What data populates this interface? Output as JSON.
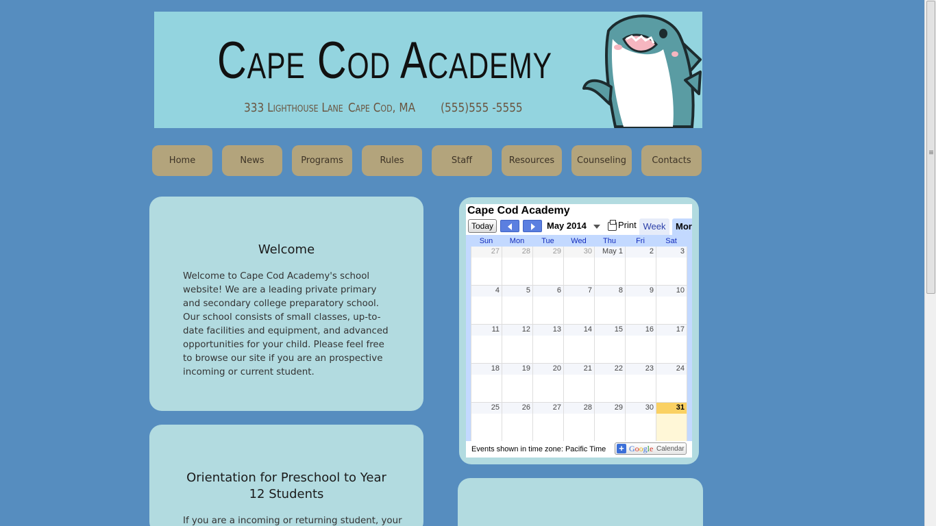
{
  "banner": {
    "title": "Cape Cod Academy",
    "street": "333 Lighthouse Lane",
    "city": "Cape Cod, MA",
    "phone": "(555)555 -5555",
    "mascot": "shark-mascot"
  },
  "nav": {
    "items": [
      {
        "label": "Home"
      },
      {
        "label": "News"
      },
      {
        "label": "Programs"
      },
      {
        "label": "Rules"
      },
      {
        "label": "Staff"
      },
      {
        "label": "Resources"
      },
      {
        "label": "Counseling"
      },
      {
        "label": "Contacts"
      }
    ]
  },
  "welcome": {
    "title": "Welcome",
    "text": "Welcome to Cape Cod Academy's school website! We are a leading private primary and secondary college preparatory school. Our school consists of small classes, up-to-date facilities and equipment, and advanced opportunities for your child. Please feel free to browse our site if you are an prospective incoming or current student."
  },
  "orientation": {
    "title": "Orientation for Preschool to Year 12 Students",
    "text": "If you are a incoming or returning student, your"
  },
  "calendar": {
    "title": "Cape Cod Academy",
    "today_label": "Today",
    "month_label": "May 2014",
    "print_label": "Print",
    "tab_week": "Week",
    "tab_month": "Mor",
    "weekdays": [
      "Sun",
      "Mon",
      "Tue",
      "Wed",
      "Thu",
      "Fri",
      "Sat"
    ],
    "weeks": [
      [
        {
          "d": "27",
          "o": true
        },
        {
          "d": "28",
          "o": true
        },
        {
          "d": "29",
          "o": true
        },
        {
          "d": "30",
          "o": true
        },
        {
          "d": "May 1"
        },
        {
          "d": "2"
        },
        {
          "d": "3"
        }
      ],
      [
        {
          "d": "4"
        },
        {
          "d": "5"
        },
        {
          "d": "6"
        },
        {
          "d": "7"
        },
        {
          "d": "8"
        },
        {
          "d": "9"
        },
        {
          "d": "10"
        }
      ],
      [
        {
          "d": "11"
        },
        {
          "d": "12"
        },
        {
          "d": "13"
        },
        {
          "d": "14"
        },
        {
          "d": "15"
        },
        {
          "d": "16"
        },
        {
          "d": "17"
        }
      ],
      [
        {
          "d": "18"
        },
        {
          "d": "19"
        },
        {
          "d": "20"
        },
        {
          "d": "21"
        },
        {
          "d": "22"
        },
        {
          "d": "23"
        },
        {
          "d": "24"
        }
      ],
      [
        {
          "d": "25"
        },
        {
          "d": "26"
        },
        {
          "d": "27"
        },
        {
          "d": "28"
        },
        {
          "d": "29"
        },
        {
          "d": "30"
        },
        {
          "d": "31",
          "today": true
        }
      ]
    ],
    "timezone_text": "Events shown in time zone: Pacific Time",
    "badge_google": "Google",
    "badge_calendar": "Calendar"
  },
  "colors": {
    "page_bg": "#568dbf",
    "banner_bg": "#93d4df",
    "nav_button": "#b3a47c",
    "card_bg": "#b2dbe0",
    "today_highlight": "#fad163"
  }
}
